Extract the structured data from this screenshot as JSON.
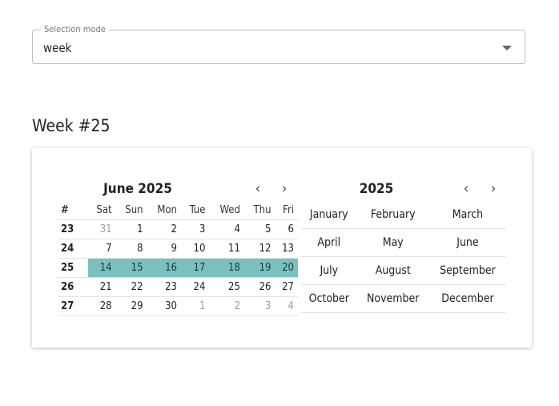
{
  "selection_mode": {
    "label": "Selection mode",
    "value": "week"
  },
  "week_title": "Week #25",
  "day_calendar": {
    "title": "June 2025",
    "prev": "‹",
    "next": "›",
    "week_header": "#",
    "weekdays": [
      "Sat",
      "Sun",
      "Mon",
      "Tue",
      "Wed",
      "Thu",
      "Fri"
    ],
    "weeks": [
      {
        "number": "23",
        "days": [
          "31",
          "1",
          "2",
          "3",
          "4",
          "5",
          "6"
        ]
      },
      {
        "number": "24",
        "days": [
          "7",
          "8",
          "9",
          "10",
          "11",
          "12",
          "13"
        ]
      },
      {
        "number": "25",
        "days": [
          "14",
          "15",
          "16",
          "17",
          "18",
          "19",
          "20"
        ]
      },
      {
        "number": "26",
        "days": [
          "21",
          "22",
          "23",
          "24",
          "25",
          "26",
          "27"
        ]
      },
      {
        "number": "27",
        "days": [
          "28",
          "29",
          "30",
          "1",
          "2",
          "3",
          "4"
        ]
      }
    ],
    "selected_week": "25",
    "selected_color": "#78c1bf"
  },
  "month_calendar": {
    "title": "2025",
    "prev": "‹",
    "next": "›",
    "months": [
      [
        "January",
        "February",
        "March"
      ],
      [
        "April",
        "May",
        "June"
      ],
      [
        "July",
        "August",
        "September"
      ],
      [
        "October",
        "November",
        "December"
      ]
    ]
  }
}
